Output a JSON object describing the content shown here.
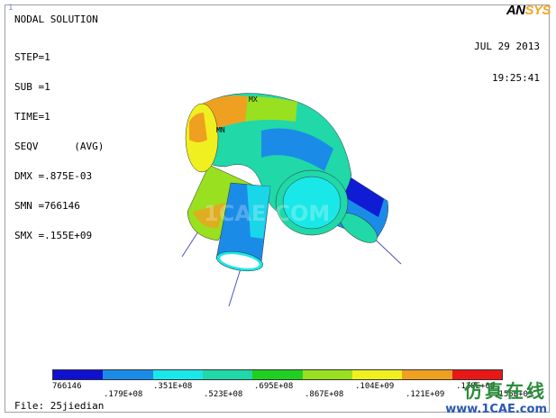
{
  "window": {
    "number": "1"
  },
  "header": {
    "title": "NODAL SOLUTION",
    "info_lines": [
      "STEP=1",
      "SUB =1",
      "TIME=1",
      "SEQV      (AVG)",
      "DMX =.875E-03",
      "SMN =766146",
      "SMX =.155E+09"
    ],
    "date": "JUL 29 2013",
    "time": "19:25:41"
  },
  "logo": {
    "part1": "AN",
    "part2": "SYS"
  },
  "model": {
    "max_label": "MX",
    "min_label": "MN",
    "watermark": "1CAE.COM"
  },
  "legend": {
    "colors": [
      "#1010d0",
      "#1a8ce8",
      "#1ae8e8",
      "#20d8a8",
      "#20d020",
      "#98e020",
      "#f0f020",
      "#f0a020",
      "#e81818"
    ],
    "top_labels": [
      "766146",
      ".351E+08",
      ".695E+08",
      ".104E+09",
      ".138E+09"
    ],
    "bottom_labels": [
      ".179E+08",
      ".523E+08",
      ".867E+08",
      ".121E+09",
      ".155E+09"
    ]
  },
  "footer": {
    "file": "File: 25jiedian"
  },
  "brand_watermark": {
    "cn": "仿真在线",
    "url": "www.1CAE.com"
  }
}
